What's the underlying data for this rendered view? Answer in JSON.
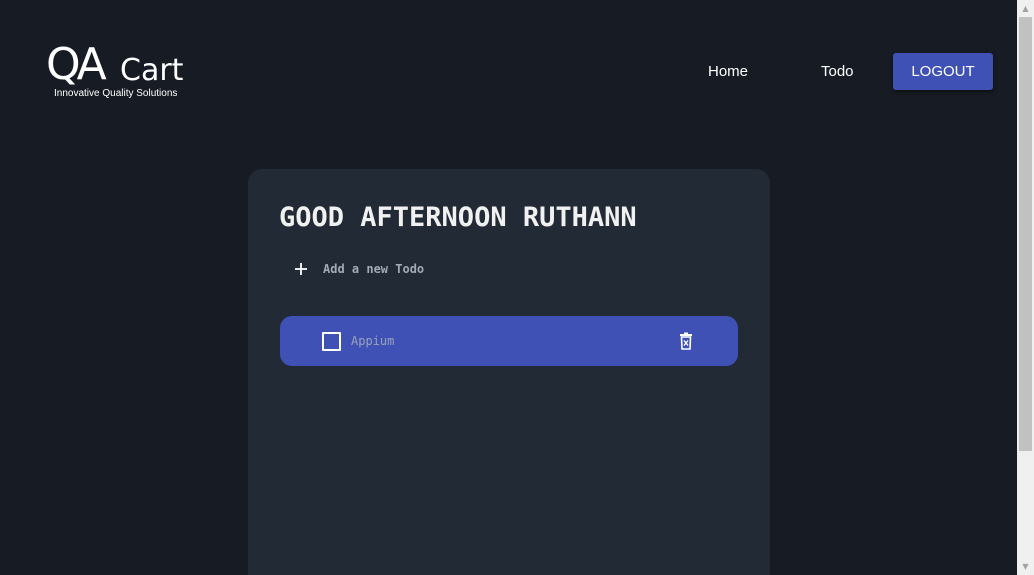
{
  "header": {
    "logo": {
      "mark": "QA",
      "name": "Cart",
      "tagline": "Innovative Quality Solutions"
    },
    "nav": [
      {
        "label": "Home"
      },
      {
        "label": "Todo"
      }
    ],
    "logout_label": "LOGOUT"
  },
  "card": {
    "greeting": "GOOD AFTERNOON RUTHANN",
    "add_label": "Add a new Todo",
    "todos": [
      {
        "label": "Appium",
        "checked": false
      }
    ]
  },
  "icons": {
    "add": "plus-icon",
    "delete": "trash-icon",
    "checkbox": "checkbox-empty"
  },
  "colors": {
    "background": "#171c24",
    "card": "#212a35",
    "accent": "#3f51b5",
    "muted_text": "#a4aab4"
  }
}
